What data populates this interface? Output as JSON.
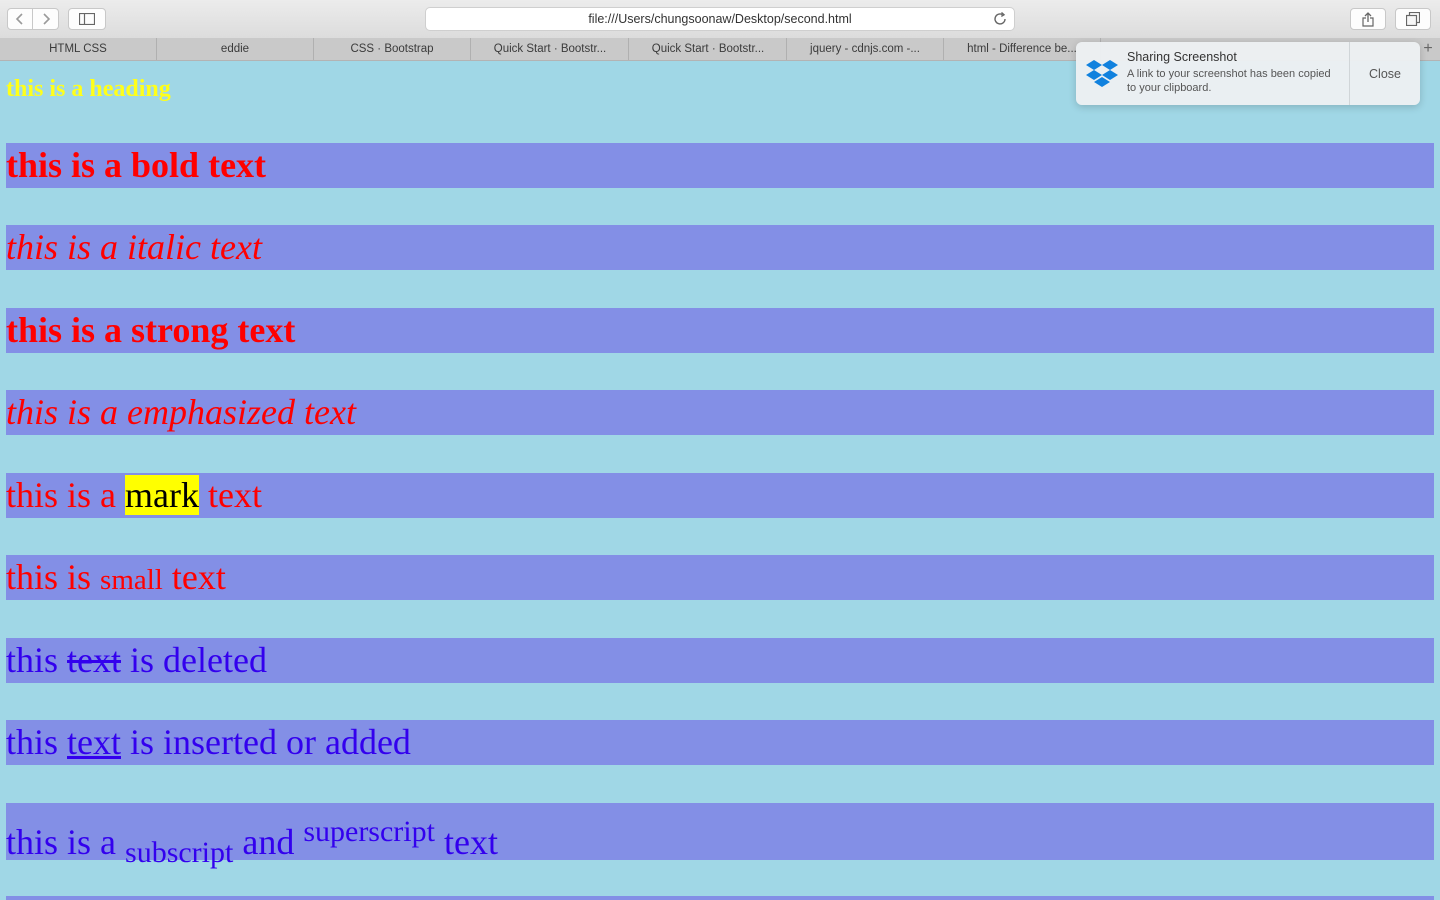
{
  "browser": {
    "url": "file:///Users/chungsoonaw/Desktop/second.html",
    "tabs": [
      "HTML CSS",
      "eddie",
      "CSS · Bootstrap",
      "Quick Start · Bootstr...",
      "Quick Start · Bootstr...",
      "jquery - cdnjs.com -...",
      "html - Difference be..."
    ],
    "new_tab_symbol": "+"
  },
  "notification": {
    "title": "Sharing Screenshot",
    "body": "A link to your screenshot has been copied to your clipboard.",
    "close_label": "Close",
    "icon": "dropbox-icon",
    "accent": "#1081de"
  },
  "page": {
    "heading": "this is a heading",
    "bold": "this is a bold text",
    "italic": "this is a italic text",
    "strong": "this is a strong text",
    "emphasized": "this is a emphasized text",
    "mark": {
      "before": "this is a ",
      "marked": "mark",
      "after": " text"
    },
    "small": {
      "before": "this is ",
      "small": "small",
      "after": " text"
    },
    "deleted": {
      "before": "this ",
      "deleted": "text",
      "after": " is deleted"
    },
    "inserted": {
      "before": "this ",
      "inserted": "text",
      "after": " is inserted or added"
    },
    "subsup": {
      "before": "this is a ",
      "sub": "subscript",
      "middle": " and ",
      "sup": "superscript",
      "after": " text"
    }
  },
  "colors": {
    "page_background": "#a0d7e6",
    "row_background": "#838fe6",
    "heading": "#ffff1a",
    "red_text": "#ff0000",
    "blue_text": "#3300ee",
    "mark_background": "#ffff00"
  }
}
